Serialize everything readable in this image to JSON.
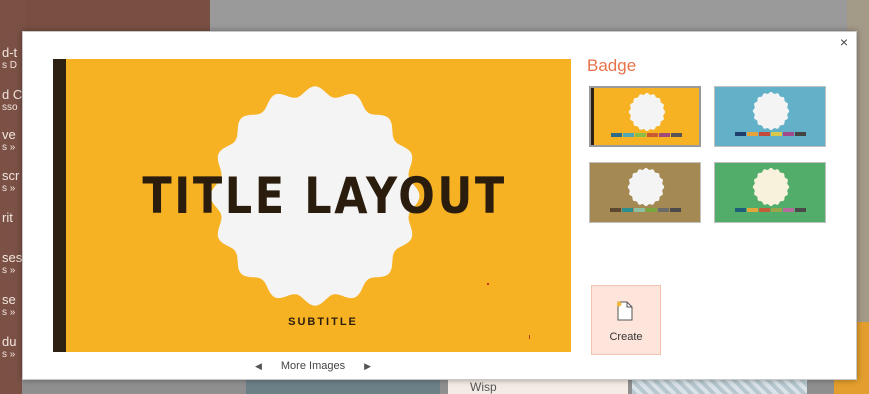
{
  "background": {
    "left_fragments": [
      "d-t",
      "s D",
      "d C",
      "sso",
      "ve",
      "s »",
      "scr",
      "s »",
      "rit",
      "ses",
      "s »",
      "se",
      "s »",
      "du",
      "s »"
    ],
    "thumb_label": "Wisp"
  },
  "dialog": {
    "close_label": "×",
    "preview": {
      "title": "TITLE LAYOUT",
      "subtitle": "SUBTITLE"
    },
    "more_images_label": "More Images",
    "prev_arrow": "◀",
    "next_arrow": "▶",
    "theme_name": "Badge",
    "variants": [
      {
        "name": "variant-1",
        "bg": "#f6b222",
        "badge": "#f4f4f4",
        "swatches": [
          "#2d6b8a",
          "#4fa7b5",
          "#8dbd49",
          "#c55a33",
          "#9e4a7a",
          "#555555"
        ]
      },
      {
        "name": "variant-2",
        "bg": "#63b1c8",
        "badge": "#f4f4f4",
        "swatches": [
          "#1f3f6e",
          "#e8a23a",
          "#c44b3b",
          "#d8c94a",
          "#a34a8b",
          "#444444"
        ]
      },
      {
        "name": "variant-3",
        "bg": "#a48a52",
        "badge": "#f4f4f4",
        "swatches": [
          "#5c4731",
          "#2c8f8f",
          "#8cc0a0",
          "#7aa63f",
          "#6a6a6a",
          "#4a4a4a"
        ]
      },
      {
        "name": "variant-4",
        "bg": "#53ad6a",
        "badge": "#f8f1dc",
        "swatches": [
          "#1f5f7a",
          "#e2a63a",
          "#c55d3a",
          "#9aa54a",
          "#b56b9b",
          "#4a4a4a"
        ]
      }
    ],
    "create_label": "Create",
    "accent_color": "#e8734a"
  }
}
